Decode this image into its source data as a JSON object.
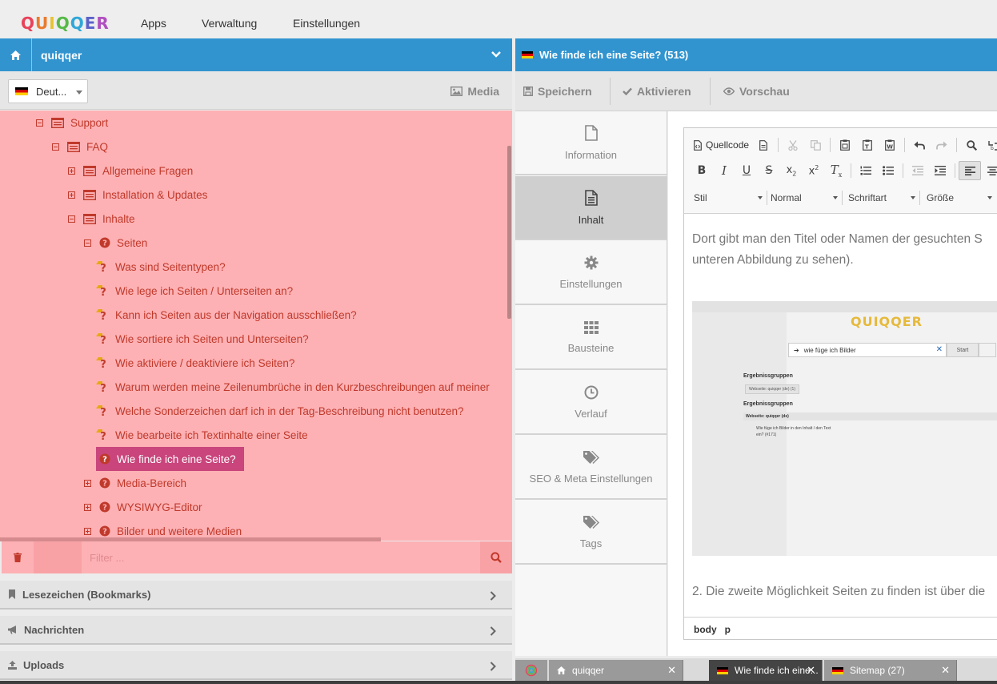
{
  "app": {
    "logo": "QUIQQER"
  },
  "topnav": {
    "items": [
      "Apps",
      "Verwaltung",
      "Einstellungen"
    ]
  },
  "left_panel": {
    "title": "quiqqer",
    "language": "Deut...",
    "media_label": "Media",
    "tree": [
      {
        "label": "Support",
        "level": 0,
        "toggle": "minus",
        "icon": "list"
      },
      {
        "label": "FAQ",
        "level": 1,
        "toggle": "minus",
        "icon": "list"
      },
      {
        "label": "Allgemeine Fragen",
        "level": 2,
        "toggle": "plus",
        "icon": "list"
      },
      {
        "label": "Installation & Updates",
        "level": 2,
        "toggle": "plus",
        "icon": "list"
      },
      {
        "label": "Inhalte",
        "level": 2,
        "toggle": "minus",
        "icon": "list"
      },
      {
        "label": "Seiten",
        "level": 3,
        "toggle": "minus",
        "icon": "question"
      },
      {
        "label": "Was sind Seitentypen?",
        "level": 4,
        "toggle": "none",
        "icon": "faq"
      },
      {
        "label": "Wie lege ich Seiten / Unterseiten an?",
        "level": 4,
        "toggle": "none",
        "icon": "faq"
      },
      {
        "label": "Kann ich Seiten aus der Navigation ausschließen?",
        "level": 4,
        "toggle": "none",
        "icon": "faq"
      },
      {
        "label": "Wie sortiere ich Seiten und Unterseiten?",
        "level": 4,
        "toggle": "none",
        "icon": "faq"
      },
      {
        "label": "Wie aktiviere / deaktiviere ich Seiten?",
        "level": 4,
        "toggle": "none",
        "icon": "faq"
      },
      {
        "label": "Warum werden meine Zeilenumbrüche in den Kurzbeschreibungen auf meiner",
        "level": 4,
        "toggle": "none",
        "icon": "faq"
      },
      {
        "label": "Welche Sonderzeichen darf ich in der Tag-Beschreibung nicht benutzen?",
        "level": 4,
        "toggle": "none",
        "icon": "faq"
      },
      {
        "label": "Wie bearbeite ich Textinhalte einer Seite",
        "level": 4,
        "toggle": "none",
        "icon": "faq"
      },
      {
        "label": "Wie finde ich eine Seite?",
        "level": 4,
        "toggle": "none",
        "icon": "question-sel",
        "selected": true
      },
      {
        "label": "Media-Bereich",
        "level": 3,
        "toggle": "plus",
        "icon": "question"
      },
      {
        "label": "WYSIWYG-Editor",
        "level": 3,
        "toggle": "plus",
        "icon": "question"
      },
      {
        "label": "Bilder und weitere Medien",
        "level": 3,
        "toggle": "plus",
        "icon": "question"
      }
    ],
    "filter_placeholder": "Filter ...",
    "accordion": [
      {
        "label": "Lesezeichen (Bookmarks)",
        "icon": "bookmark-icon"
      },
      {
        "label": "Nachrichten",
        "icon": "bullhorn-icon"
      },
      {
        "label": "Uploads",
        "icon": "upload-icon"
      }
    ]
  },
  "right_panel": {
    "title": "Wie finde ich eine Seite? (513)",
    "toolbar": {
      "save": "Speichern",
      "activate": "Aktivieren",
      "preview": "Vorschau"
    },
    "categories": [
      {
        "label": "Information",
        "icon": "file-icon"
      },
      {
        "label": "Inhalt",
        "icon": "file-text-icon",
        "active": true
      },
      {
        "label": "Einstellungen",
        "icon": "gear-icon"
      },
      {
        "label": "Bausteine",
        "icon": "grid-icon"
      },
      {
        "label": "Verlauf",
        "icon": "clock-icon"
      },
      {
        "label": "SEO & Meta Einstellungen",
        "icon": "tags-icon"
      },
      {
        "label": "Tags",
        "icon": "tags-icon"
      }
    ],
    "editor": {
      "source_label": "Quellcode",
      "combos": [
        "Stil",
        "Normal",
        "Schriftart",
        "Größe"
      ],
      "paragraph1_line1": "Dort gibt man den Titel oder Namen der gesuchten S",
      "paragraph1_line2": "unteren Abbildung zu sehen).",
      "paragraph2": "2. Die zweite Möglichkeit Seiten zu finden ist über die",
      "path": [
        "body",
        "p"
      ],
      "screenshot": {
        "logo": "QUIQQER",
        "search_value": "wie füge ich Bilder",
        "search_button": "Start",
        "heading1": "Ergebnissgruppen",
        "chip": "Webseite: quiqqer (de) (1)",
        "heading2": "Ergebnissgruppen",
        "group_bar": "Webseite: quiqqer (de)",
        "result_line1": "Wie füge ich Bilder in den Inhalt / den Text",
        "result_line2": "ein? (#171)"
      }
    }
  },
  "taskbar": {
    "tasks": [
      {
        "label": "quiqqer",
        "icon": "home-icon"
      },
      {
        "label": "Wie finde ich eine...",
        "icon": "flag-de-icon",
        "active": true
      },
      {
        "label": "Sitemap (27)",
        "icon": "flag-de-icon"
      }
    ]
  },
  "colors": {
    "accent": "#3194cf",
    "tree_bg": "#fdb1b4",
    "tree_text": "#c0392b",
    "selected": "#c9457c"
  }
}
